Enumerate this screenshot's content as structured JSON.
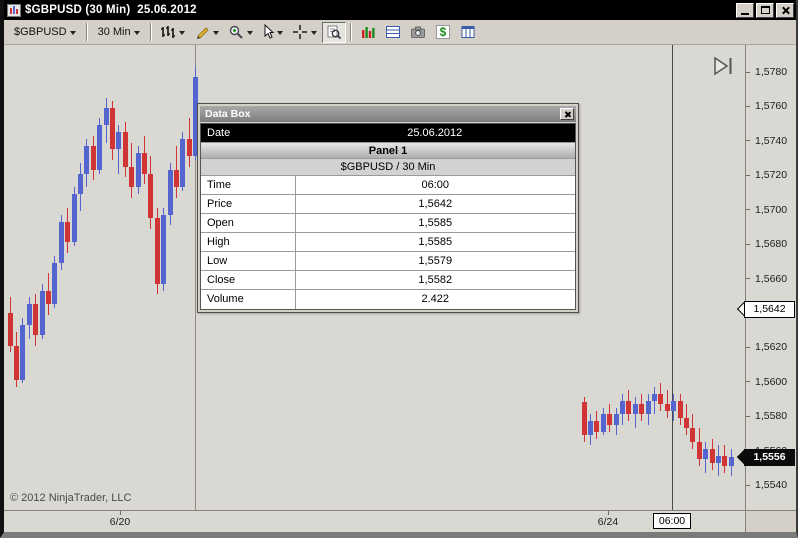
{
  "window": {
    "title": "$GBPUSD (30 Min)  25.06.2012"
  },
  "toolbar": {
    "instrument_label": "$GBPUSD",
    "interval_label": "30 Min",
    "dollar_glyph": "$",
    "icons": [
      "chart-style",
      "drawing-tools",
      "zoom",
      "cursor",
      "crosshair",
      "data-box",
      "chart-panel",
      "grid",
      "snapshot",
      "account-dollar",
      "columns"
    ]
  },
  "databox": {
    "title": "Data Box",
    "date_label": "Date",
    "date_value": "25.06.2012",
    "panel_label": "Panel 1",
    "instrument_label": "$GBPUSD / 30 Min",
    "fields": [
      {
        "label": "Time",
        "value": "06:00"
      },
      {
        "label": "Price",
        "value": "1,5642"
      },
      {
        "label": "Open",
        "value": "1,5585"
      },
      {
        "label": "High",
        "value": "1,5585"
      },
      {
        "label": "Low",
        "value": "1,5579"
      },
      {
        "label": "Close",
        "value": "1,5582"
      },
      {
        "label": "Volume",
        "value": "2.422"
      }
    ]
  },
  "footer": {
    "copyright": "© 2012 NinjaTrader, LLC"
  },
  "chart_data": {
    "type": "candlestick",
    "title": "$GBPUSD (30 Min) 25.06.2012",
    "instrument": "$GBPUSD",
    "interval": "30 Min",
    "grid": false,
    "layout": {
      "y_top": 27,
      "y_bottom": 440
    },
    "price_axis": {
      "max": 1.578,
      "min": 1.554,
      "step": 0.002,
      "labels": [
        "1,5780",
        "1,5760",
        "1,5740",
        "1,5720",
        "1,5700",
        "1,5680",
        "1,5660",
        "1,5640",
        "1,5620",
        "1,5600",
        "1,5580",
        "1,5560",
        "1,5540"
      ]
    },
    "time_axis_labels": [
      {
        "text": "6/20",
        "x": 116
      },
      {
        "text": "6/24",
        "x": 604
      }
    ],
    "cursor": {
      "time_label": "06:00",
      "x": 668,
      "price_label": "1,5642",
      "price": 1.5642
    },
    "session_break_x": 191,
    "last_price": {
      "label": "1,5556",
      "price": 1.5556
    },
    "colors": {
      "up": "#5565cf",
      "down": "#d13434"
    },
    "series": [
      {
        "name": "session-6/20",
        "x0": 6,
        "dx": 6.4,
        "bars": [
          [
            1.564,
            1.5649,
            1.5617,
            1.5621
          ],
          [
            1.5621,
            1.5629,
            1.5597,
            1.5601
          ],
          [
            1.5601,
            1.5637,
            1.5599,
            1.5633
          ],
          [
            1.5633,
            1.5649,
            1.5625,
            1.5645
          ],
          [
            1.5645,
            1.5651,
            1.5621,
            1.5627
          ],
          [
            1.5627,
            1.5657,
            1.5625,
            1.5653
          ],
          [
            1.5653,
            1.5663,
            1.5639,
            1.5645
          ],
          [
            1.5645,
            1.5673,
            1.5643,
            1.5669
          ],
          [
            1.5669,
            1.5697,
            1.5665,
            1.5693
          ],
          [
            1.5693,
            1.5701,
            1.5675,
            1.5681
          ],
          [
            1.5681,
            1.5713,
            1.5679,
            1.5709
          ],
          [
            1.5709,
            1.5727,
            1.5699,
            1.5721
          ],
          [
            1.5721,
            1.5741,
            1.5713,
            1.5737
          ],
          [
            1.5737,
            1.5743,
            1.5717,
            1.5723
          ],
          [
            1.5723,
            1.5753,
            1.5721,
            1.5749
          ],
          [
            1.5749,
            1.5765,
            1.5739,
            1.5759
          ],
          [
            1.5759,
            1.5763,
            1.5729,
            1.5735
          ],
          [
            1.5735,
            1.5749,
            1.5721,
            1.5745
          ],
          [
            1.5745,
            1.5751,
            1.5719,
            1.5725
          ],
          [
            1.5725,
            1.5739,
            1.5707,
            1.5713
          ],
          [
            1.5713,
            1.5737,
            1.5709,
            1.5733
          ],
          [
            1.5733,
            1.5743,
            1.5715,
            1.5721
          ],
          [
            1.5721,
            1.5731,
            1.5689,
            1.5695
          ],
          [
            1.5695,
            1.5701,
            1.5651,
            1.5657
          ],
          [
            1.5657,
            1.5701,
            1.5653,
            1.5697
          ],
          [
            1.5697,
            1.5727,
            1.5691,
            1.5723
          ],
          [
            1.5723,
            1.5737,
            1.5707,
            1.5713
          ],
          [
            1.5713,
            1.5745,
            1.5711,
            1.5741
          ],
          [
            1.5741,
            1.5753,
            1.5725,
            1.5731
          ],
          [
            1.5731,
            1.5783,
            1.5729,
            1.5777
          ]
        ]
      },
      {
        "name": "session-6/24",
        "x0": 580,
        "dx": 6.4,
        "bars": [
          [
            1.5588,
            1.5591,
            1.5565,
            1.5569
          ],
          [
            1.5569,
            1.5581,
            1.5563,
            1.5577
          ],
          [
            1.5577,
            1.5583,
            1.5567,
            1.5571
          ],
          [
            1.5571,
            1.5585,
            1.5569,
            1.5581
          ],
          [
            1.5581,
            1.5587,
            1.5571,
            1.5575
          ],
          [
            1.5575,
            1.5585,
            1.5569,
            1.5581
          ],
          [
            1.5581,
            1.5593,
            1.5575,
            1.5589
          ],
          [
            1.5589,
            1.5595,
            1.5577,
            1.5581
          ],
          [
            1.5581,
            1.5591,
            1.5573,
            1.5587
          ],
          [
            1.5587,
            1.5593,
            1.5577,
            1.5581
          ],
          [
            1.5581,
            1.5593,
            1.5575,
            1.5589
          ],
          [
            1.5589,
            1.5597,
            1.5581,
            1.5593
          ],
          [
            1.5593,
            1.5599,
            1.5583,
            1.5587
          ],
          [
            1.5587,
            1.5595,
            1.5579,
            1.5583
          ],
          [
            1.5583,
            1.5593,
            1.5577,
            1.5589
          ],
          [
            1.5589,
            1.5593,
            1.5575,
            1.5579
          ],
          [
            1.5579,
            1.5587,
            1.5569,
            1.5573
          ],
          [
            1.5573,
            1.5581,
            1.5561,
            1.5565
          ],
          [
            1.5565,
            1.5573,
            1.5551,
            1.5555
          ],
          [
            1.5555,
            1.5565,
            1.5547,
            1.5561
          ],
          [
            1.5561,
            1.5567,
            1.5549,
            1.5553
          ],
          [
            1.5553,
            1.5563,
            1.5545,
            1.5557
          ],
          [
            1.5557,
            1.5563,
            1.5547,
            1.5551
          ],
          [
            1.5551,
            1.5561,
            1.5545,
            1.5556
          ]
        ]
      }
    ]
  }
}
